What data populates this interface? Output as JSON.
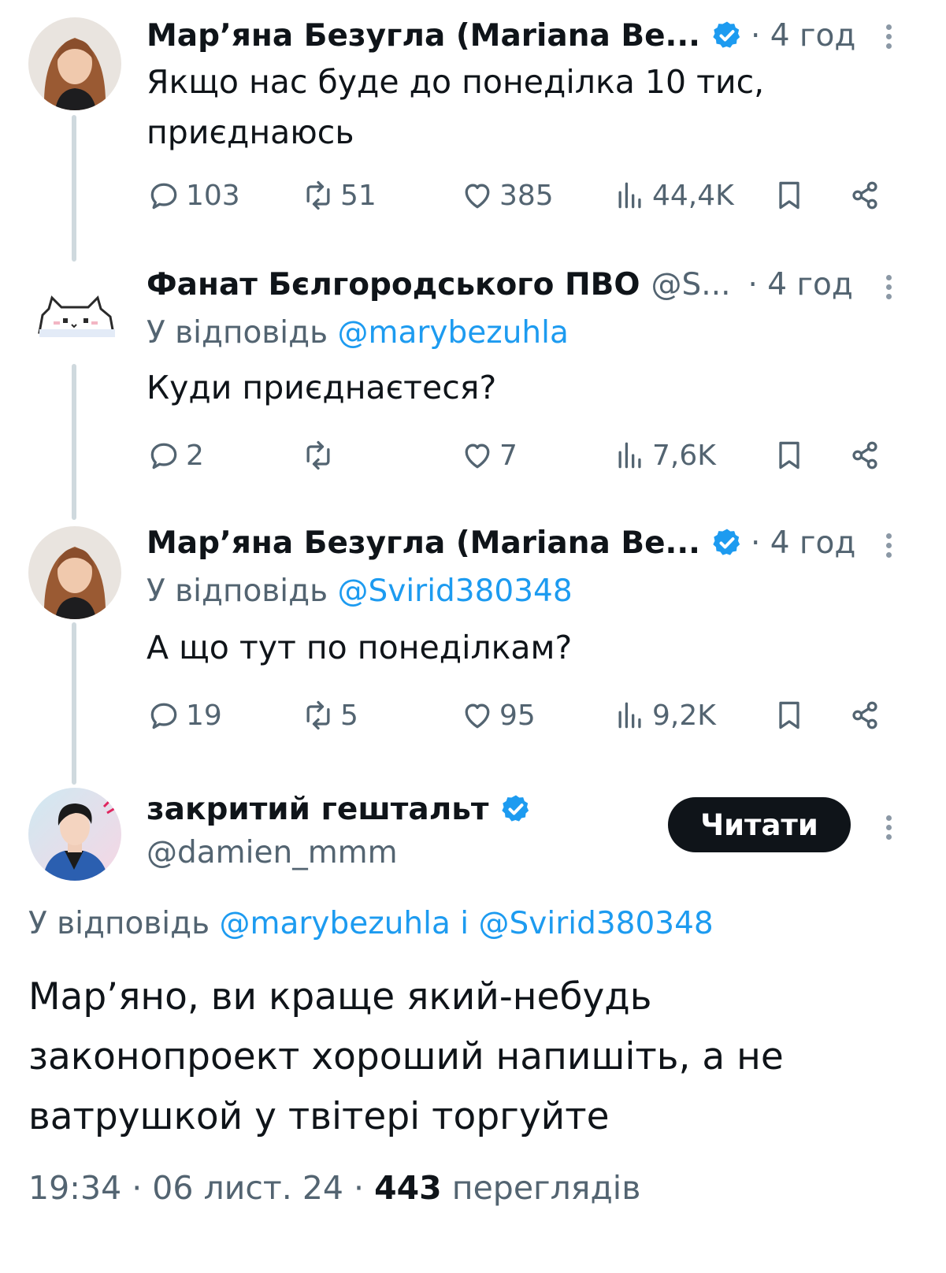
{
  "colors": {
    "accent": "#1d9bf0",
    "text": "#0f1419",
    "muted": "#536471",
    "line": "#cfd9de"
  },
  "tweets": [
    {
      "author_name": "Мар’яна Безугла (Mariana Be...",
      "verified": true,
      "time": "· 4 год",
      "text": "Якщо нас буде до понеділка 10 тис, приєднаюсь",
      "replies": "103",
      "retweets": "51",
      "likes": "385",
      "views": "44,4K"
    },
    {
      "author_name": "Фанат Бєлгородського ПВО",
      "handle": "@S...",
      "time": "· 4 год",
      "reply_prefix": "У відповідь",
      "reply_to": "@marybezuhla",
      "text": "Куди приєднаєтеся?",
      "replies": "2",
      "retweets": "",
      "likes": "7",
      "views": "7,6K"
    },
    {
      "author_name": "Мар’яна Безугла (Mariana Be...",
      "verified": true,
      "time": "· 4 год",
      "reply_prefix": "У відповідь",
      "reply_to": "@Svirid380348",
      "text": "А що тут по понеділкам?",
      "replies": "19",
      "retweets": "5",
      "likes": "95",
      "views": "9,2K"
    }
  ],
  "main_tweet": {
    "author_name": "закритий гештальт",
    "verified": true,
    "handle": "@damien_mmm",
    "follow_label": "Читати",
    "reply_prefix": "У відповідь",
    "reply_to_1": "@marybezuhla",
    "reply_joiner": "і",
    "reply_to_2": "@Svirid380348",
    "text": "Мар’яно, ви краще який-небудь законопроект хороший напишіть, а не ватрушкой у твітері торгуйте",
    "time": "19:34",
    "date": "06 лист. 24",
    "views_count": "443",
    "views_label": "переглядів"
  }
}
